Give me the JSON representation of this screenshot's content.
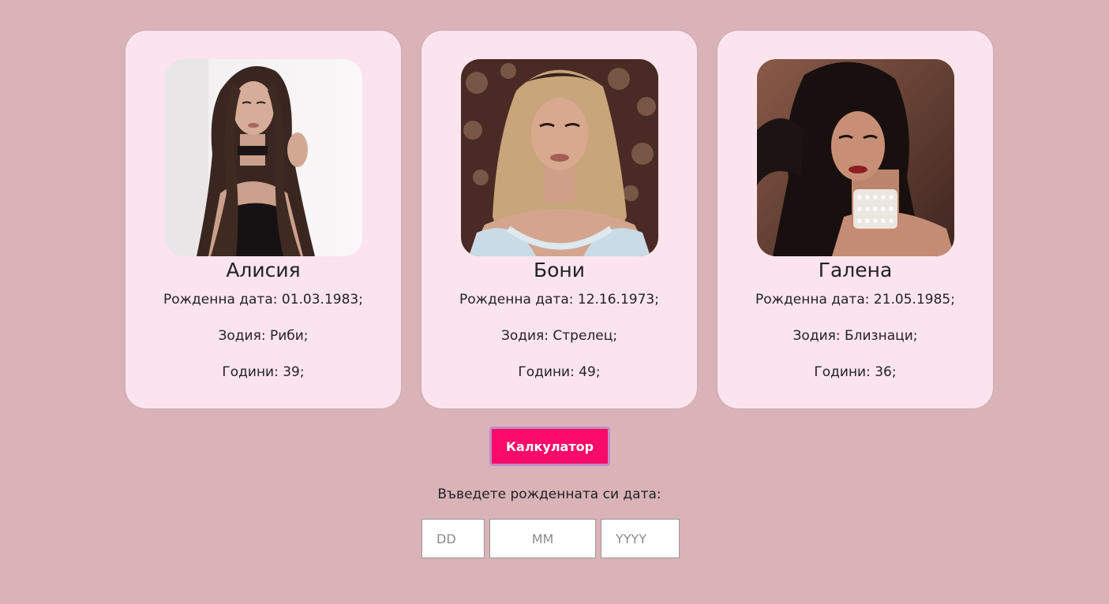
{
  "cards": [
    {
      "name": "Алисия",
      "birthdate": "Рожденна дата: 01.03.1983;",
      "zodiac": "Зодия: Риби;",
      "age": "Години: 39;"
    },
    {
      "name": "Бони",
      "birthdate": "Рожденна дата: 12.16.1973;",
      "zodiac": "Зодия: Стрелец;",
      "age": "Години: 49;"
    },
    {
      "name": "Галена",
      "birthdate": "Рожденна дата: 21.05.1985;",
      "zodiac": "Зодия: Близнаци;",
      "age": "Години: 36;"
    }
  ],
  "calculator": {
    "button_label": "Калкулатор",
    "prompt": "Въведете рожденната си дата:",
    "day_placeholder": "DD",
    "month_placeholder": "MM",
    "year_placeholder": "YYYY"
  },
  "colors": {
    "page_background": "#d9b3b8",
    "card_background": "#fbe4ee",
    "button_background": "#fa0a69",
    "button_border": "#bf8cc4"
  }
}
